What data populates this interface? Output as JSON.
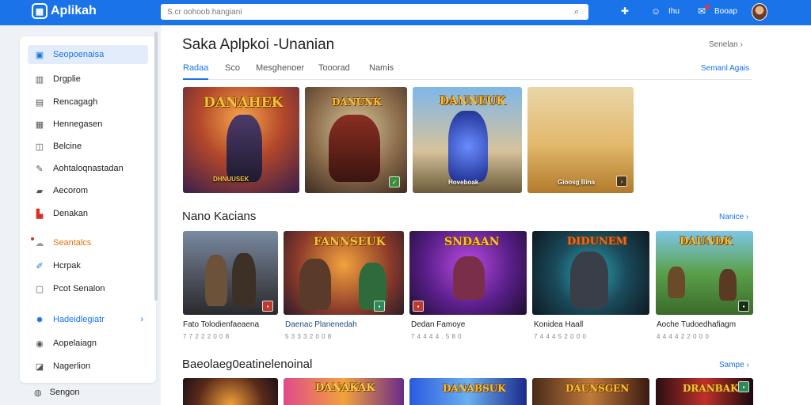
{
  "app": {
    "name": "Aplikah"
  },
  "search": {
    "placeholder": "S.cr oohoob.hangiani"
  },
  "header": {
    "user_label": "Ihu",
    "notif_label": "Booap"
  },
  "sidebar": {
    "items": [
      {
        "label": "Seopoenaisa",
        "icon": "home-icon"
      },
      {
        "label": "Drgplie",
        "icon": "grid-icon"
      },
      {
        "label": "Rencagagh",
        "icon": "calendar-icon"
      },
      {
        "label": "Hennegasen",
        "icon": "chart-icon"
      },
      {
        "label": "Belcine",
        "icon": "book-icon"
      },
      {
        "label": "Aohtaloqnastadan",
        "icon": "wrench-icon"
      },
      {
        "label": "Aecorom",
        "icon": "folder-icon"
      },
      {
        "label": "Denakan",
        "icon": "store-icon"
      },
      {
        "label": "Seantalcs",
        "icon": "cloud-icon"
      },
      {
        "label": "Hcrpak",
        "icon": "edit-icon"
      },
      {
        "label": "Pcot Senalon",
        "icon": "list-icon"
      },
      {
        "label": "Hadeidlegiatr",
        "icon": "gear-icon"
      },
      {
        "label": "Aopelaiagn",
        "icon": "clock-icon"
      },
      {
        "label": "Nagerlion",
        "icon": "image-icon"
      },
      {
        "label": "Sengon",
        "icon": "help-icon"
      }
    ]
  },
  "main": {
    "title": "Saka Aplpkoi -Unanian",
    "top_see_all": "Senelan",
    "tabs_see_all": "Semanl Agais",
    "tabs": [
      "Radaa",
      "Sco",
      "Mesghenoer",
      "Tooorad",
      "Namis"
    ]
  },
  "featured": [
    {
      "art_title": "DANAHEK",
      "caption": "DHNUUSEK"
    },
    {
      "art_title": "DANUNK",
      "caption": ""
    },
    {
      "art_title": "DANNEUK",
      "caption": "Hoveboak"
    },
    {
      "art_title": "",
      "caption": "Gioosg Bina"
    }
  ],
  "section_new": {
    "title": "Nano Kacians",
    "see_all": "Nanice",
    "games": [
      {
        "art_title": "",
        "name": "Fato Tolodienfaeaena",
        "rating": "7 7 2 2 2 0 0 8"
      },
      {
        "art_title": "FANNSEUK",
        "name": "Daenac Planenedah",
        "rating": "5 3 3 3 2 0 0 8"
      },
      {
        "art_title": "SNDAAN",
        "name": "Dedan Famoye",
        "rating": "7 4 4 4 4 . 5 8 0"
      },
      {
        "art_title": "DIDUNEM",
        "name": "Konidea Haall",
        "rating": "7 4 4 4 5 2 0 0 0"
      },
      {
        "art_title": "DAUNDK",
        "name": "Aoche Tudoedhafiagm",
        "rating": "4 4 4 4 2 2 0 0 0"
      }
    ]
  },
  "section_third": {
    "title": "Baeolaeg0eatinelenoinal",
    "see_all": "Sampe",
    "games": [
      {
        "art_title": ""
      },
      {
        "art_title": "DANAKAK"
      },
      {
        "art_title": "DANABSUK"
      },
      {
        "art_title": "DAUNSGEN"
      },
      {
        "art_title": "DRANBAK"
      }
    ]
  },
  "colors": {
    "accent": "#1a73e8",
    "topbar": "#1a73e8",
    "sidebar_active_bg": "#e3ecfa"
  }
}
